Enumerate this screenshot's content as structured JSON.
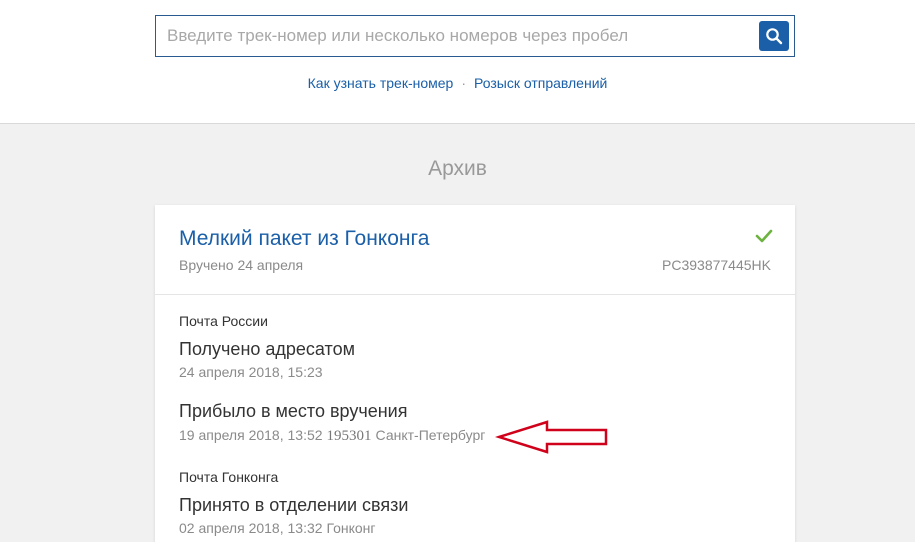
{
  "search": {
    "placeholder": "Введите трек-номер или несколько номеров через пробел"
  },
  "links": {
    "how_to_find": "Как узнать трек-номер",
    "separator": "·",
    "search_shipments": "Розыск отправлений"
  },
  "archive": {
    "title": "Архив"
  },
  "package": {
    "title": "Мелкий пакет из Гонконга",
    "status": "Вручено 24 апреля",
    "track_number": "PC393877445HK",
    "status_icon": "check-icon",
    "status_color": "#6cb33f"
  },
  "events": [
    {
      "source": "Почта России",
      "title": "Получено адресатом",
      "date": "24 апреля 2018, 15:23"
    },
    {
      "title": "Прибыло в место вручения",
      "date": "19 апреля 2018, 13:52",
      "index": "195301",
      "place": "Санкт-Петербург"
    },
    {
      "source": "Почта Гонконга",
      "title": "Принято в отделении связи",
      "date": "02 апреля 2018, 13:32",
      "place": "Гонконг"
    }
  ],
  "colors": {
    "link": "#1a5fa8",
    "annotation_arrow": "#d0021b"
  }
}
